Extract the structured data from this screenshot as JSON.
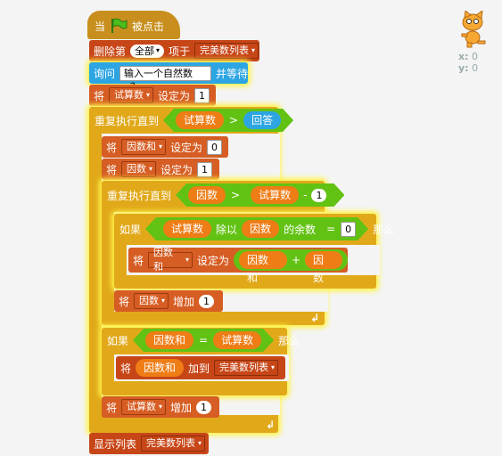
{
  "hat": {
    "prefix": "当",
    "suffix": "被点击"
  },
  "delete_item": {
    "prefix": "删除第",
    "index": "全部",
    "middle": "项于",
    "list": "完美数列表"
  },
  "ask": {
    "label": "询问",
    "question": "输入一个自然数n？",
    "suffix": "并等待"
  },
  "set_test": {
    "prefix": "将",
    "var": "试算数",
    "middle": "设定为",
    "value": "1"
  },
  "repeat_outer": {
    "label": "重复执行直到",
    "left": "试算数",
    "op": ">",
    "right": "回答"
  },
  "set_sum": {
    "prefix": "将",
    "var": "因数和",
    "middle": "设定为",
    "value": "0"
  },
  "set_factor": {
    "prefix": "将",
    "var": "因数",
    "middle": "设定为",
    "value": "1"
  },
  "repeat_inner": {
    "label": "重复执行直到",
    "left": "因数",
    "gt": ">",
    "minus_left": "试算数",
    "minus": "-",
    "minus_right": "1"
  },
  "if_mod": {
    "label": "如果",
    "mod_left": "试算数",
    "mod_word": "除以",
    "mod_right": "因数",
    "mod_suffix": "的余数",
    "eq": "=",
    "value": "0",
    "then": "那么"
  },
  "set_sum_add": {
    "prefix": "将",
    "var": "因数和",
    "middle": "设定为",
    "add_left": "因数和",
    "plus": "+",
    "add_right": "因数"
  },
  "change_factor": {
    "prefix": "将",
    "var": "因数",
    "middle": "增加",
    "value": "1"
  },
  "if_perfect": {
    "label": "如果",
    "left": "因数和",
    "eq": "=",
    "right": "试算数",
    "then": "那么"
  },
  "add_to_list": {
    "prefix": "将",
    "item": "因数和",
    "middle": "加到",
    "list": "完美数列表"
  },
  "change_test": {
    "prefix": "将",
    "var": "试算数",
    "middle": "增加",
    "value": "1"
  },
  "show_list": {
    "label": "显示列表",
    "list": "完美数列表"
  },
  "sprite": {
    "x_label": "x:",
    "x_value": "0",
    "y_label": "y:",
    "y_value": "0"
  },
  "colors": {
    "events": "#c88f1e",
    "control": "#e1a91a",
    "data": "#d65d23",
    "list": "#c74618",
    "sensing": "#2ca5e2",
    "operators": "#62c213",
    "glow": "#fff34a"
  }
}
